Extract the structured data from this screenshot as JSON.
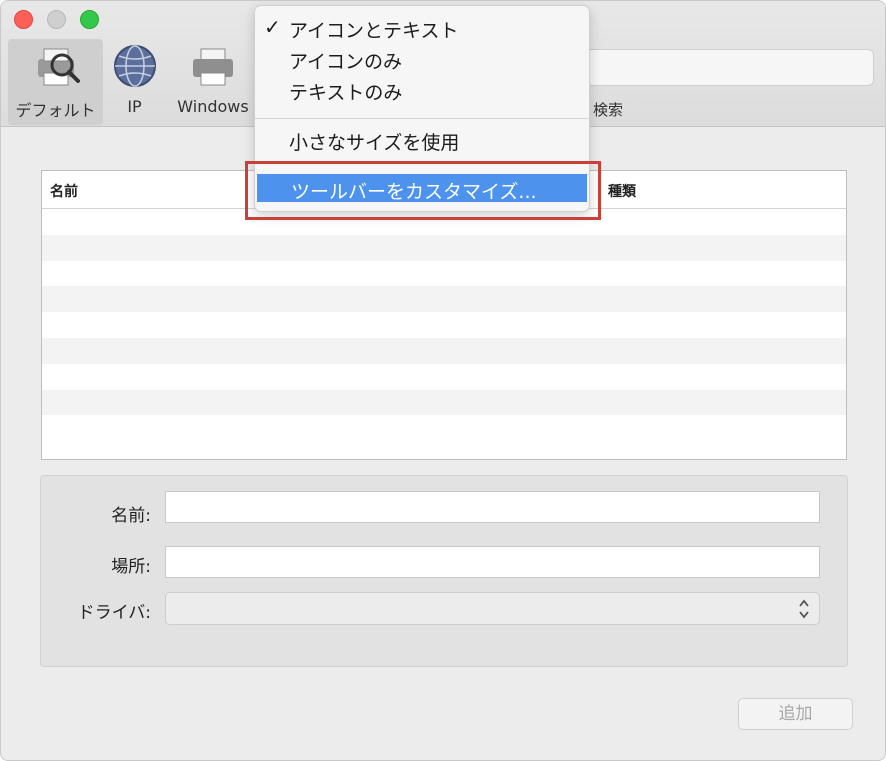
{
  "toolbar": {
    "items": [
      {
        "label": "デフォルト",
        "icon": "printer-search-icon"
      },
      {
        "label": "IP",
        "icon": "globe-icon"
      },
      {
        "label": "Windows",
        "icon": "printer-icon"
      }
    ],
    "search_label": "検索"
  },
  "table": {
    "columns": [
      "名前",
      "種類"
    ],
    "rows": []
  },
  "form": {
    "name_label": "名前:",
    "location_label": "場所:",
    "driver_label": "ドライバ:",
    "name_value": "",
    "location_value": "",
    "driver_value": ""
  },
  "add_button": "追加",
  "context_menu": {
    "items": [
      {
        "label": "アイコンとテキスト",
        "checked": true
      },
      {
        "label": "アイコンのみ",
        "checked": false
      },
      {
        "label": "テキストのみ",
        "checked": false
      },
      {
        "label": "小さなサイズを使用",
        "checked": false
      },
      {
        "label": "ツールバーをカスタマイズ...",
        "checked": false,
        "highlighted": true
      }
    ],
    "check_mark": "✓"
  },
  "colors": {
    "highlight": "#4d93ee",
    "callout": "#c9403b",
    "close": "#fc5f57",
    "zoom": "#34c84a"
  }
}
